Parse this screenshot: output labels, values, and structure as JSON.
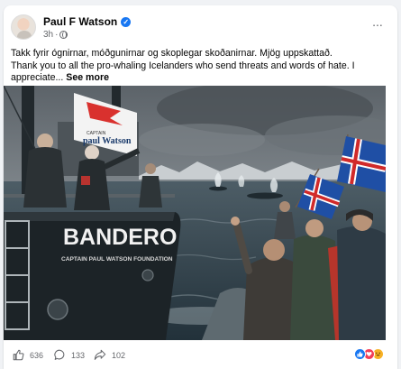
{
  "post": {
    "author": "Paul F Watson",
    "time": "3h",
    "visibility_icon": "globe-icon",
    "more_options_label": "...",
    "text_line1": "Takk fyrir ógnirnar, móðgunirnar og skoplegar skoðanirnar. Mjög uppskattað.",
    "text_line2": "Thank you to all the pro-whaling Icelanders who send threats and words of hate. I appreciate...",
    "see_more": "See more"
  },
  "photo": {
    "boat_name": "BANDERO",
    "boat_subtitle": "CAPTAIN PAUL WATSON FOUNDATION",
    "banner_top": "CAPTAIN",
    "banner_name": "paul Watson"
  },
  "actions": {
    "likes": "636",
    "comments": "133",
    "shares": "102"
  },
  "colors": {
    "facebook_blue": "#1877f2",
    "text_secondary": "#65676b",
    "love_red": "#f33e58",
    "haha_yellow": "#f7b125"
  }
}
